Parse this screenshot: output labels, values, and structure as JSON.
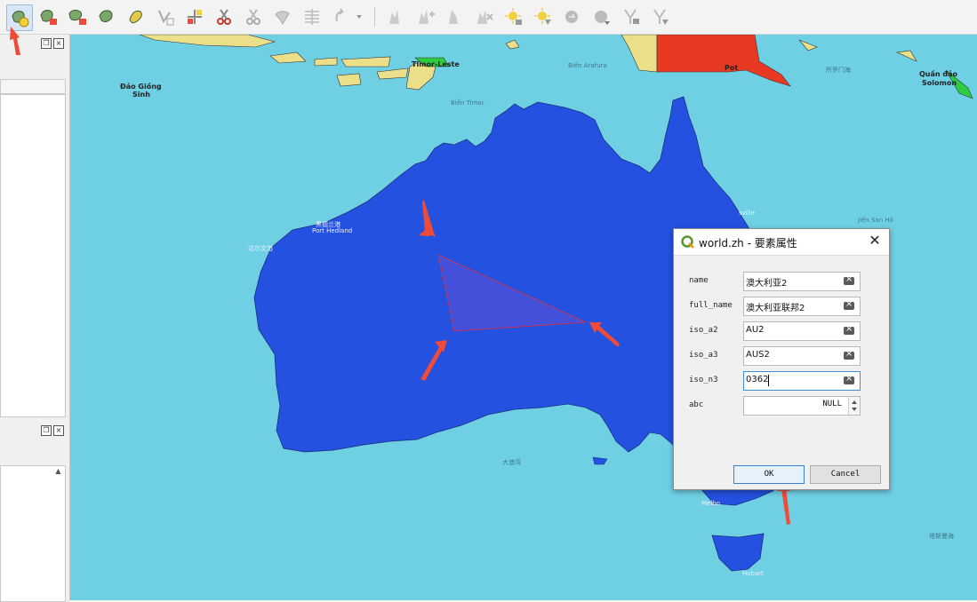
{
  "toolbar": {
    "buttons": [
      {
        "name": "add-polygon-feature-icon",
        "active": true
      },
      {
        "name": "delete-ring-icon"
      },
      {
        "name": "delete-part-icon"
      },
      {
        "name": "fill-ring-icon"
      },
      {
        "name": "offset-curve-icon"
      },
      {
        "name": "vertex-tool-icon"
      },
      {
        "name": "merge-vertices-icon"
      },
      {
        "name": "split-features-icon"
      },
      {
        "name": "split-parts-icon"
      },
      {
        "name": "reshape-icon"
      },
      {
        "name": "align-icon"
      },
      {
        "name": "rotate-dropdown-icon"
      },
      {
        "name": "label-pin-icon"
      },
      {
        "name": "label-move-icon"
      },
      {
        "name": "label-rotate-icon"
      },
      {
        "name": "label-change-icon"
      },
      {
        "name": "diagram-show-icon"
      },
      {
        "name": "diagram-move-icon"
      },
      {
        "name": "label-toggle-icon"
      },
      {
        "name": "label-unpin-icon"
      },
      {
        "name": "annotation-icon"
      },
      {
        "name": "annotation-move-icon"
      }
    ]
  },
  "map": {
    "labels": {
      "dao_giang": "Đảo Giồng",
      "sinh": "Sinh",
      "timor": "Timor-Leste",
      "bien_arafura": "Biển Arafura",
      "bien_timor": "Biển Timor",
      "pot": "Pot",
      "torres": "所罗门海",
      "quan_dao": "Quần đảo",
      "solomon": "Solomon",
      "jien_san_ho": "Jiển San Hô",
      "port_hedland": "黑德兰港",
      "fort_hedland": "Port Hedland",
      "dampier": "达尔文港",
      "aus_sea": "大澳湾",
      "melbourne": "Melbo",
      "hobart": "Hobart",
      "tasman": "塔斯曼海",
      "townsville": "sville"
    }
  },
  "dialog": {
    "title": "world.zh - 要素属性",
    "close_symbol": "✕",
    "fields": [
      {
        "label": "name",
        "value": "澳大利亚2"
      },
      {
        "label": "full_name",
        "value": "澳大利亚联邦2"
      },
      {
        "label": "iso_a2",
        "value": "AU2"
      },
      {
        "label": "iso_a3",
        "value": "AUS2"
      },
      {
        "label": "iso_n3",
        "value": "0362"
      },
      {
        "label": "abc",
        "value": "NULL"
      }
    ],
    "ok_label": "OK",
    "cancel_label": "Cancel"
  },
  "colors": {
    "sea": "#6fd0e4",
    "australia": "#2451e0",
    "new_polygon_fill": "#4a4fd8",
    "new_polygon_stroke": "#e0303a",
    "png": "#e83a22",
    "timor": "#2ecc40",
    "islands": "#ecdf8a",
    "annotation_arrow": "#ef4b38"
  }
}
